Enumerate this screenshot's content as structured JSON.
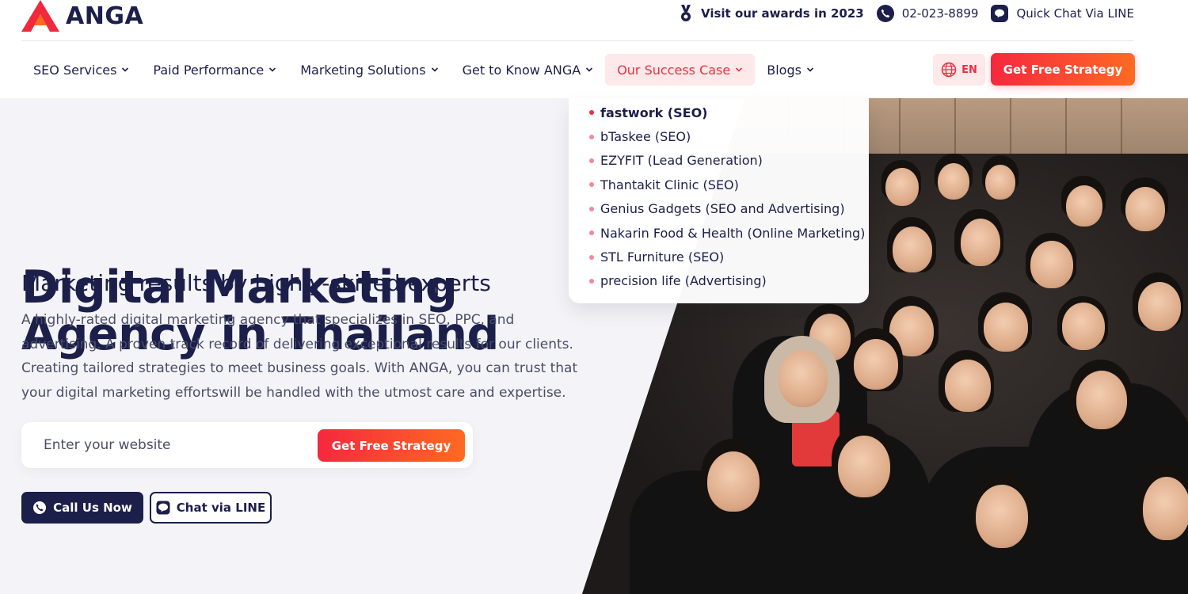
{
  "brand": {
    "name": "ANGA",
    "accent": "#e8303f",
    "navy": "#1b1f4a"
  },
  "topbar": {
    "awards": {
      "icon": "award-ribbon-icon",
      "label": "Visit our awards in 2023"
    },
    "phone": {
      "icon": "phone-icon",
      "label": "02-023-8899"
    },
    "line": {
      "icon": "line-chat-icon",
      "label": "Quick Chat Via LINE"
    }
  },
  "nav": {
    "items": [
      {
        "label": "SEO Services"
      },
      {
        "label": "Paid Performance"
      },
      {
        "label": "Marketing Solutions"
      },
      {
        "label": "Get to Know ANGA"
      },
      {
        "label": "Our Success Case"
      },
      {
        "label": "Blogs"
      }
    ],
    "language": "EN",
    "cta": "Get Free Strategy"
  },
  "dropdown": {
    "items": [
      {
        "label": "fastwork (SEO)"
      },
      {
        "label": "bTaskee (SEO)"
      },
      {
        "label": "EZYFIT (Lead Generation)"
      },
      {
        "label": "Thantakit Clinic (SEO)"
      },
      {
        "label": "Genius Gadgets (SEO and Advertising)"
      },
      {
        "label": "Nakarin Food & Health (Online Marketing)"
      },
      {
        "label": "STL Furniture (SEO)"
      },
      {
        "label": "precision life (Advertising)"
      }
    ]
  },
  "hero": {
    "title_line1": "Digital Marketing",
    "title_line2": "Agency in Thailand",
    "subtitle": "Marketing results by highly-skilled experts",
    "description": "A highly-rated digital marketing agency that specializes in SEO, PPC, and advertising. A proven track record of delivering exceptional results for our clients. Creating tailored strategies to meet business goals. With ANGA, you can trust that your digital marketing effortswill be handled with the utmost care and expertise.",
    "search": {
      "placeholder": "Enter your website",
      "value": ""
    },
    "search_cta": "Get Free Strategy",
    "call_button": "Call Us Now",
    "line_button": "Chat via LINE"
  }
}
